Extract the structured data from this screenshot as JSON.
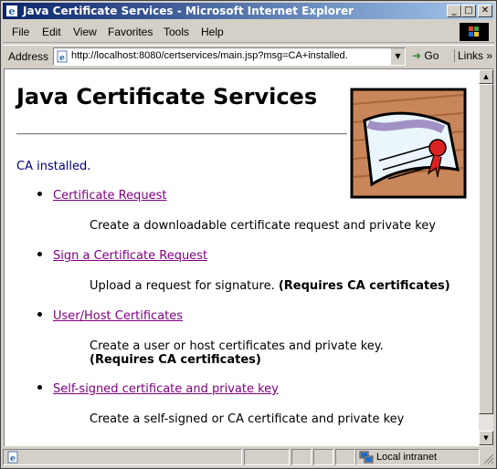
{
  "window": {
    "title": "Java Certificate Services - Microsoft Internet Explorer",
    "buttons": {
      "minimize": "_",
      "maximize": "□",
      "close": "✕"
    }
  },
  "menu": {
    "items": [
      "File",
      "Edit",
      "View",
      "Favorites",
      "Tools",
      "Help"
    ]
  },
  "address": {
    "label": "Address",
    "url": "http://localhost:8080/certservices/main.jsp?msg=CA+installed.",
    "go_label": "Go",
    "links_label": "Links"
  },
  "page": {
    "title": "Java Certificate Services",
    "status": "CA installed.",
    "services": [
      {
        "link": "Certificate Request",
        "desc": "Create a downloadable certificate request and private key",
        "req": ""
      },
      {
        "link": "Sign a Certificate Request",
        "desc": "Upload a request for signature.",
        "req": "(Requires CA certificates)"
      },
      {
        "link": "User/Host Certificates",
        "desc": "Create a user or host certificates and private key.",
        "req": "(Requires CA certificates)"
      },
      {
        "link": "Self-signed certificate and private key",
        "desc": "Create a self-signed or CA certificate and private key",
        "req": ""
      }
    ]
  },
  "statusbar": {
    "zone": "Local intranet"
  },
  "colors": {
    "link_visited": "#800080",
    "status_text": "#000080",
    "titlebar_start": "#0a246a",
    "titlebar_end": "#a6caf0"
  }
}
